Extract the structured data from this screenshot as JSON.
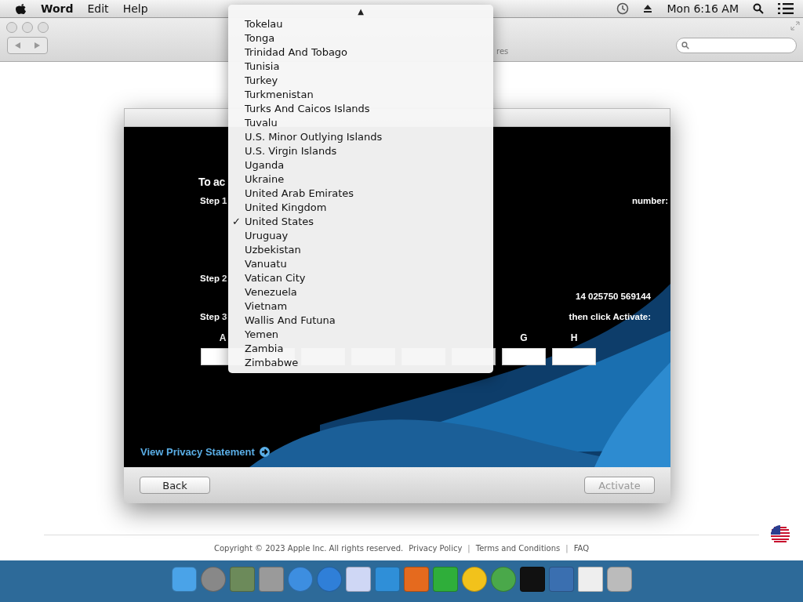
{
  "menu_bar": {
    "app": "Word",
    "menus": [
      "Edit",
      "Help"
    ],
    "clock": "Mon 6:16 AM"
  },
  "toolbar": {
    "tab_fragment": "res"
  },
  "dialog": {
    "heading": "To ac",
    "steps": [
      {
        "label": "Step 1",
        "text": "number:"
      },
      {
        "label": "Step 2",
        "detail": "14 025750 569144"
      },
      {
        "label": "Step 3",
        "text": "then click Activate:"
      }
    ],
    "fields": [
      {
        "kind": "labeled",
        "label": "A"
      },
      {
        "kind": "unlabeled"
      },
      {
        "kind": "unlabeled"
      },
      {
        "kind": "unlabeled"
      },
      {
        "kind": "unlabeled"
      },
      {
        "kind": "unlabeled"
      },
      {
        "kind": "labeled",
        "label": "G"
      },
      {
        "kind": "labeled",
        "label": "H"
      }
    ],
    "privacy_link": "View Privacy Statement",
    "buttons": [
      {
        "label": "Back",
        "disabled": false
      },
      {
        "label": "Activate",
        "disabled": true
      }
    ]
  },
  "country_menu": {
    "scroll_arrow": "▲",
    "check_mark": "✓",
    "items": [
      {
        "label": "Tokelau",
        "selected": false
      },
      {
        "label": "Tonga",
        "selected": false
      },
      {
        "label": "Trinidad And Tobago",
        "selected": false
      },
      {
        "label": "Tunisia",
        "selected": false
      },
      {
        "label": "Turkey",
        "selected": false
      },
      {
        "label": "Turkmenistan",
        "selected": false
      },
      {
        "label": "Turks And Caicos Islands",
        "selected": false
      },
      {
        "label": "Tuvalu",
        "selected": false
      },
      {
        "label": "U.S. Minor Outlying Islands",
        "selected": false
      },
      {
        "label": "U.S. Virgin Islands",
        "selected": false
      },
      {
        "label": "Uganda",
        "selected": false
      },
      {
        "label": "Ukraine",
        "selected": false
      },
      {
        "label": "United Arab Emirates",
        "selected": false
      },
      {
        "label": "United Kingdom",
        "selected": false
      },
      {
        "label": "United States",
        "selected": true
      },
      {
        "label": "Uruguay",
        "selected": false
      },
      {
        "label": "Uzbekistan",
        "selected": false
      },
      {
        "label": "Vanuatu",
        "selected": false
      },
      {
        "label": "Vatican City",
        "selected": false
      },
      {
        "label": "Venezuela",
        "selected": false
      },
      {
        "label": "Vietnam",
        "selected": false
      },
      {
        "label": "Wallis And Futuna",
        "selected": false
      },
      {
        "label": "Yemen",
        "selected": false
      },
      {
        "label": "Zambia",
        "selected": false
      },
      {
        "label": "Zimbabwe",
        "selected": false
      }
    ]
  },
  "footer": {
    "items": [
      {
        "kind": "text",
        "text": "Copyright © 2023 Apple Inc. All rights reserved."
      },
      {
        "kind": "link",
        "text": "Privacy Policy"
      },
      {
        "kind": "separator",
        "text": "|"
      },
      {
        "kind": "link",
        "text": "Terms and Conditions"
      },
      {
        "kind": "separator",
        "text": "|"
      },
      {
        "kind": "link",
        "text": "FAQ"
      }
    ]
  }
}
